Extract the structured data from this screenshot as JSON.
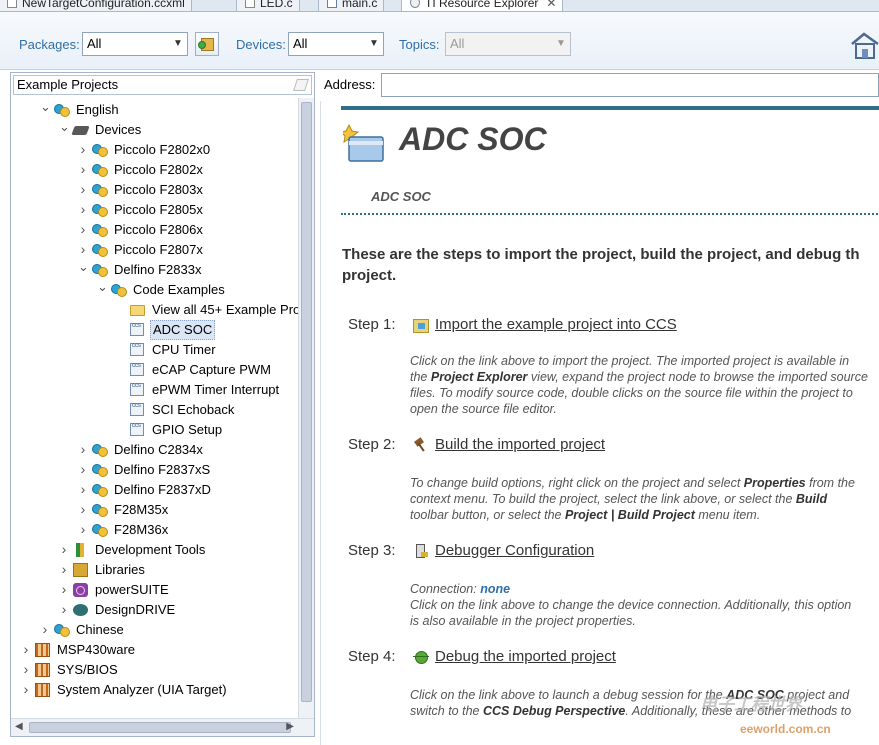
{
  "tabs": [
    {
      "label": "NewTargetConfiguration.ccxml",
      "icon": "file-icon"
    },
    {
      "label": "LED.c",
      "icon": "c-file-icon"
    },
    {
      "label": "main.c",
      "icon": "c-file-icon"
    },
    {
      "label": "TI Resource Explorer",
      "icon": "globe-icon",
      "active": true
    }
  ],
  "toolbar": {
    "packages_label": "Packages:",
    "packages_value": "All",
    "devices_label": "Devices:",
    "devices_value": "All",
    "topics_label": "Topics:",
    "topics_value": "All"
  },
  "tree": {
    "filter_value": "Example Projects",
    "nodes": [
      {
        "label": "English",
        "level": 1,
        "expanded": true,
        "icon": "pair-icon"
      },
      {
        "label": "Devices",
        "level": 2,
        "expanded": true,
        "icon": "chip-icon"
      },
      {
        "label": "Piccolo F2802x0",
        "level": 3,
        "expanded": false,
        "icon": "pair-icon"
      },
      {
        "label": "Piccolo F2802x",
        "level": 3,
        "expanded": false,
        "icon": "pair-icon"
      },
      {
        "label": "Piccolo F2803x",
        "level": 3,
        "expanded": false,
        "icon": "pair-icon"
      },
      {
        "label": "Piccolo F2805x",
        "level": 3,
        "expanded": false,
        "icon": "pair-icon"
      },
      {
        "label": "Piccolo F2806x",
        "level": 3,
        "expanded": false,
        "icon": "pair-icon"
      },
      {
        "label": "Piccolo F2807x",
        "level": 3,
        "expanded": false,
        "icon": "pair-icon"
      },
      {
        "label": "Delfino F2833x",
        "level": 3,
        "expanded": true,
        "icon": "pair-icon"
      },
      {
        "label": "Code Examples",
        "level": 4,
        "expanded": true,
        "icon": "pair-icon"
      },
      {
        "label": "View all 45+ Example Pro",
        "level": 5,
        "icon": "folder-icon"
      },
      {
        "label": "ADC SOC",
        "level": 5,
        "icon": "ccs-project-icon",
        "selected": true
      },
      {
        "label": "CPU Timer",
        "level": 5,
        "icon": "ccs-project-icon"
      },
      {
        "label": "eCAP Capture PWM",
        "level": 5,
        "icon": "ccs-project-icon"
      },
      {
        "label": "ePWM Timer Interrupt",
        "level": 5,
        "icon": "ccs-project-icon"
      },
      {
        "label": "SCI Echoback",
        "level": 5,
        "icon": "ccs-project-icon"
      },
      {
        "label": "GPIO Setup",
        "level": 5,
        "icon": "ccs-project-icon"
      },
      {
        "label": "Delfino C2834x",
        "level": 3,
        "expanded": false,
        "icon": "pair-icon"
      },
      {
        "label": "Delfino F2837xS",
        "level": 3,
        "expanded": false,
        "icon": "pair-icon"
      },
      {
        "label": "Delfino F2837xD",
        "level": 3,
        "expanded": false,
        "icon": "pair-icon"
      },
      {
        "label": "F28M35x",
        "level": 3,
        "expanded": false,
        "icon": "pair-icon"
      },
      {
        "label": "F28M36x",
        "level": 3,
        "expanded": false,
        "icon": "pair-icon"
      },
      {
        "label": "Development Tools",
        "level": 2,
        "expanded": false,
        "icon": "devtools-icon"
      },
      {
        "label": "Libraries",
        "level": 2,
        "expanded": false,
        "icon": "books-icon"
      },
      {
        "label": "powerSUITE",
        "level": 2,
        "expanded": false,
        "icon": "powersuite-icon"
      },
      {
        "label": "DesignDRIVE",
        "level": 2,
        "expanded": false,
        "icon": "designdrive-icon"
      },
      {
        "label": "Chinese",
        "level": 1,
        "expanded": false,
        "icon": "pair-icon"
      },
      {
        "label": "MSP430ware",
        "level": 0,
        "expanded": false,
        "icon": "package-icon"
      },
      {
        "label": "SYS/BIOS",
        "level": 0,
        "expanded": false,
        "icon": "package-icon"
      },
      {
        "label": "System Analyzer (UIA Target)",
        "level": 0,
        "expanded": false,
        "icon": "package-icon"
      }
    ]
  },
  "address": {
    "label": "Address:",
    "value": ""
  },
  "content": {
    "title": "ADC SOC",
    "subtitle": "ADC SOC",
    "intro_line1": "These are the steps to import the project, build the project, and debug th",
    "intro_line2": "project.",
    "steps": [
      {
        "label": "Step 1:",
        "link": "Import the example project into CCS",
        "icon": "import-icon",
        "desc": [
          "Click on the link above to import the project. The imported project is available in",
          [
            "the ",
            "Project Explorer",
            " view, expand the project node to browse the imported source"
          ],
          "files. To modify source code, double clicks on the source file within the project to",
          "open the source file editor."
        ]
      },
      {
        "label": "Step 2:",
        "link": "Build the imported project",
        "icon": "hammer-icon",
        "desc": [
          [
            "To change build options, right click on the project and select ",
            "Properties",
            " from the"
          ],
          [
            "context menu. To build the project, select the link above, or select the ",
            "Build",
            ""
          ],
          [
            "toolbar button, or select the ",
            "Project | Build Project",
            " menu item."
          ]
        ]
      },
      {
        "label": "Step 3:",
        "link": "Debugger Configuration",
        "icon": "debugger-config-icon",
        "connection_label": "Connection:",
        "connection_value": "none",
        "desc": [
          "Click on the link above to change the device connection. Additionally, this option",
          "is also available in the project properties."
        ]
      },
      {
        "label": "Step 4:",
        "link": "Debug the imported project",
        "icon": "bug-icon",
        "desc": [
          [
            "Click on the link above to launch a debug session for the ",
            "ADC SOC",
            " project and"
          ],
          [
            "switch to the ",
            "CCS Debug Perspective",
            ". Additionally, these are other methods to"
          ]
        ]
      }
    ]
  },
  "watermark": {
    "text": "电子工程世界",
    "sub": "eeworld.com.cn"
  }
}
